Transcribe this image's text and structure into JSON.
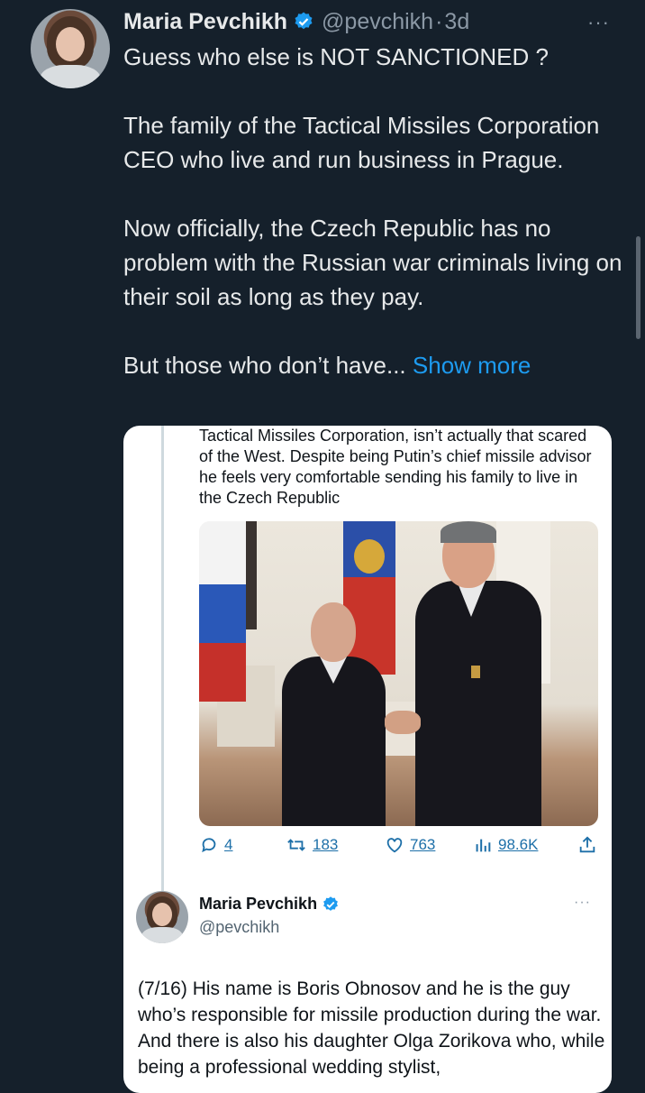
{
  "tweet": {
    "author_name": "Maria Pevchikh",
    "author_handle": "@pevchikh",
    "separator": "·",
    "time": "3d",
    "more": "···",
    "paragraphs": [
      "Guess who else is NOT SANCTIONED ?",
      "The family of the Tactical Missiles Corporation CEO who live and run business in Prague.",
      "Now officially, the Czech Republic has no problem with the Russian war criminals living on their soil as long as they pay.",
      "But those who don’t have..."
    ],
    "show_more": "Show more"
  },
  "card": {
    "top_text": "Tactical Missiles Corporation, isn’t actually that scared of the West. Despite being Putin’s chief missile advisor he feels very comfortable sending his family to live in the Czech Republic",
    "actions": {
      "replies": "4",
      "retweets": "183",
      "likes": "763",
      "views": "98.6K"
    },
    "quoted": {
      "author_name": "Maria Pevchikh",
      "author_handle": "@pevchikh",
      "more": "···",
      "text": "(7/16) His name is Boris Obnosov and he is the guy who’s responsible for missile production during the war. And there is also his daughter Olga Zorikova who, while being a professional wedding stylist,"
    }
  },
  "colors": {
    "background": "#15202b",
    "accent": "#1d9bf0",
    "text": "#e7e9ea",
    "muted": "#8b98a5",
    "card_background": "#ffffff"
  }
}
